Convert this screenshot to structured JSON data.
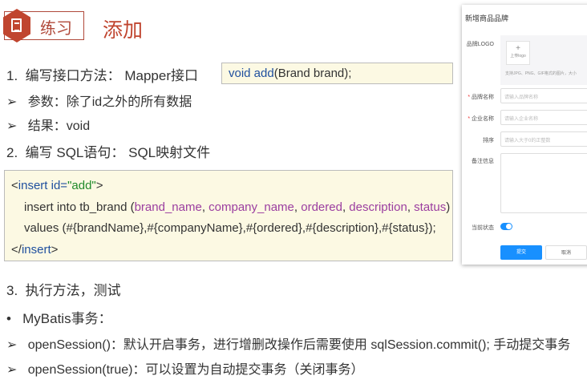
{
  "header": {
    "badge": "练习",
    "title": "添加"
  },
  "items": [
    {
      "marker": "1.",
      "text": "编写接口方法： Mapper接口"
    },
    {
      "marker": "➢",
      "text": "参数：除了id之外的所有数据"
    },
    {
      "marker": "➢",
      "text": "结果：void"
    },
    {
      "marker": "2.",
      "text": "编写 SQL语句： SQL映射文件"
    },
    {
      "marker": "3.",
      "text": "执行方法，测试"
    },
    {
      "marker": "•",
      "text": "MyBatis事务："
    },
    {
      "marker": "➢",
      "text": "openSession()：默认开启事务，进行增删改操作后需要使用 sqlSession.commit(); 手动提交事务"
    },
    {
      "marker": "➢",
      "text": "openSession(true)：可以设置为自动提交事务（关闭事务）"
    }
  ],
  "method_code": {
    "kw": "void add",
    "rest": "(Brand brand);"
  },
  "sql": {
    "l1a": "<",
    "l1b": "insert id=",
    "l1c": "\"add\"",
    "l1d": ">",
    "l2a": "insert into tb_brand (",
    "c1": "brand_name",
    ",": ", ",
    "c2": "company_name",
    "c3": "ordered",
    "c4": "description",
    "c5": "status",
    "l2e": ")",
    "l3": "values (#{brandName},#{companyName},#{ordered},#{description},#{status});",
    "l4a": "</",
    "l4b": "insert",
    "l4c": ">"
  },
  "form": {
    "title": "新增商品品牌",
    "logo_label": "品牌LOGO",
    "upload_plus": "+",
    "upload_text": "上传logo",
    "upload_hint": "支持JPG、PNG、GIF格式的图片，大小",
    "brand_label": "品牌名称",
    "brand_ph": "请输入品牌名称",
    "company_label": "企业名称",
    "company_ph": "请输入企业名称",
    "order_label": "排序",
    "order_ph": "请输入大于0的正整数",
    "remark_label": "备注信息",
    "status_label": "当前状态",
    "required_mark": "*",
    "submit": "提交",
    "cancel": "取消",
    "status_on": true
  }
}
